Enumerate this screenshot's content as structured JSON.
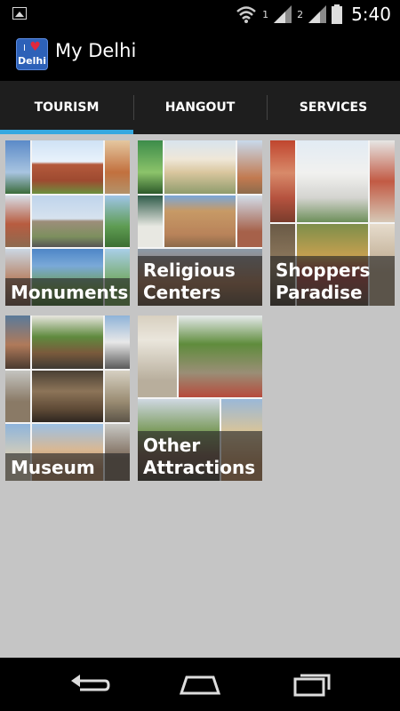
{
  "status_bar": {
    "sim1": "1",
    "sim2": "2",
    "time": "5:40",
    "icons": [
      "gallery-icon",
      "wifi-icon",
      "signal-icon",
      "battery-icon"
    ]
  },
  "app": {
    "title": "My Delhi",
    "icon_text_top": "I",
    "icon_text_bottom": "Delhi"
  },
  "tabs": [
    {
      "label": "TOURISM",
      "active": true
    },
    {
      "label": "HANGOUT",
      "active": false
    },
    {
      "label": "SERVICES",
      "active": false
    }
  ],
  "tiles": [
    {
      "label": "Monuments"
    },
    {
      "label": "Religious Centers"
    },
    {
      "label": "Shoppers Paradise"
    },
    {
      "label": "Museum"
    },
    {
      "label": "Other Attractions"
    }
  ],
  "nav": {
    "icons": [
      "back-icon",
      "home-icon",
      "recent-apps-icon"
    ]
  },
  "colors": {
    "tab_indicator": "#35a8e0",
    "background": "#c5c5c5",
    "bar": "#000000"
  }
}
